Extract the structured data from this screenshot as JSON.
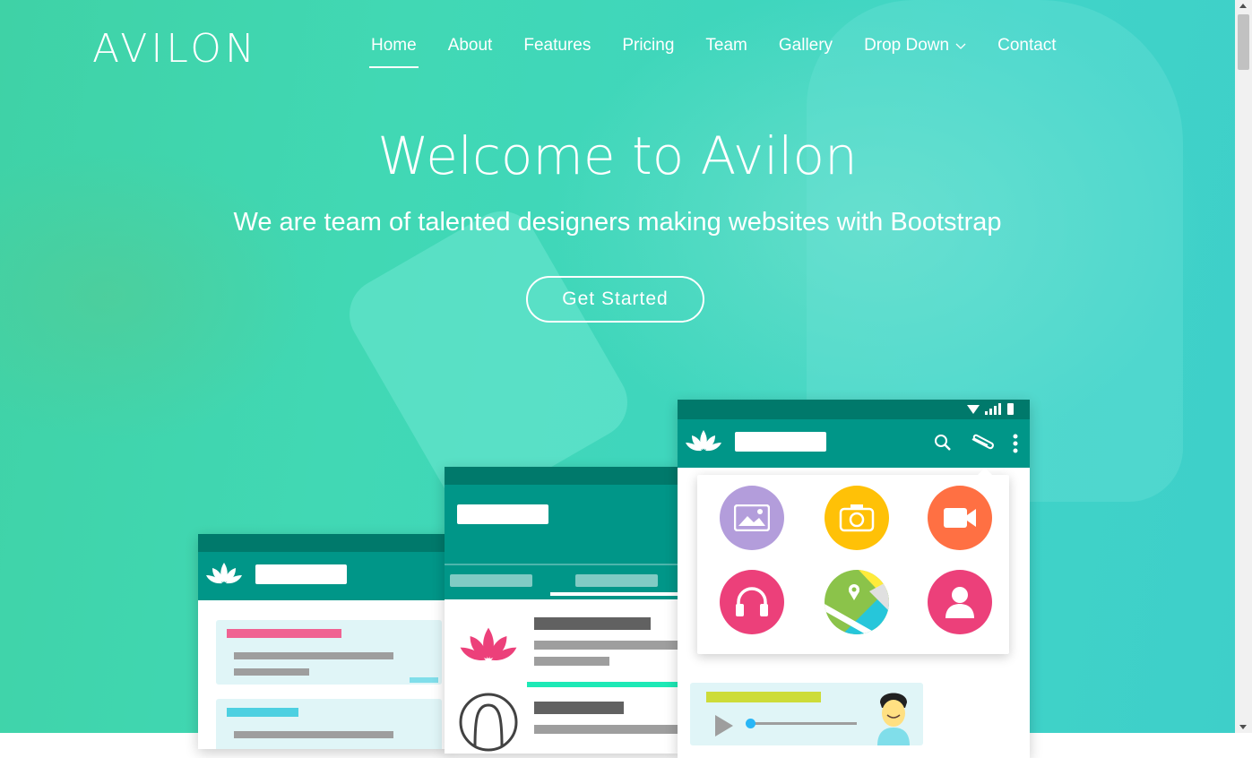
{
  "brand": {
    "logo": "AVILON"
  },
  "nav": {
    "items": [
      {
        "label": "Home",
        "active": true
      },
      {
        "label": "About"
      },
      {
        "label": "Features"
      },
      {
        "label": "Pricing"
      },
      {
        "label": "Team"
      },
      {
        "label": "Gallery"
      },
      {
        "label": "Drop Down",
        "icon": "chevron-down-icon"
      },
      {
        "label": "Contact"
      }
    ]
  },
  "hero": {
    "title": "Welcome to Avilon",
    "subtitle": "We are team of talented designers making websites with Bootstrap",
    "cta_label": "Get Started"
  },
  "colors": {
    "teal_dark": "#00796b",
    "teal": "#009688",
    "hero_green": "#41d8b4",
    "pink": "#ec407a",
    "cyan": "#4dd0e1",
    "purple": "#b39ddb",
    "amber": "#ffc107",
    "orange": "#ff7043",
    "lime": "#cddc39"
  },
  "mockup": {
    "apps": [
      "image-icon",
      "camera-icon",
      "video-icon",
      "headphones-icon",
      "map-icon",
      "person-icon"
    ],
    "toolbar_icons": [
      "search-icon",
      "attach-icon",
      "more-vert-icon"
    ],
    "status_icons": [
      "wifi-icon",
      "signal-icon",
      "battery-icon"
    ]
  }
}
